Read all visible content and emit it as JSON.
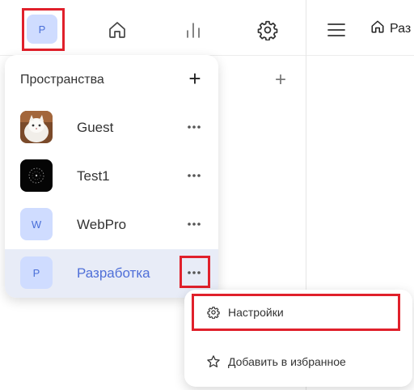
{
  "topbar": {
    "avatar_letter": "Р",
    "icons": [
      "home-icon",
      "bar-chart-icon",
      "gear-icon",
      "menu-icon"
    ],
    "breadcrumb_text": "Раз"
  },
  "workspaces": {
    "title": "Пространства",
    "add_label": "+",
    "items": [
      {
        "name": "Guest",
        "avatar": "photo-cat",
        "letter": ""
      },
      {
        "name": "Test1",
        "avatar": "photo-dark",
        "letter": ""
      },
      {
        "name": "WebPro",
        "avatar": "letter",
        "letter": "W"
      },
      {
        "name": "Разработка",
        "avatar": "letter",
        "letter": "Р",
        "active": true
      }
    ]
  },
  "context_menu": {
    "items": [
      {
        "label": "Настройки",
        "icon": "gear-icon"
      },
      {
        "label": "Добавить в избранное",
        "icon": "star-icon"
      }
    ]
  },
  "colors": {
    "accent": "#4f6fd8",
    "avatar_bg": "#cfdcff",
    "highlight": "#e0202b",
    "active_row": "#e8ecf7"
  }
}
